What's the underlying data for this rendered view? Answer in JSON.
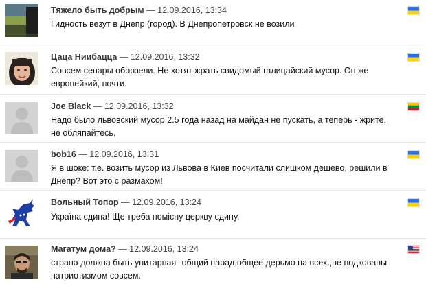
{
  "comments": [
    {
      "author": "Тяжело быть добрым",
      "separator": "—",
      "datetime": "12.09.2016, 13:34",
      "text": "Гидность везут в Днепр (город). В Днепропетровск не возили",
      "flag": "ua-flag",
      "avatar": "landscape-avatar"
    },
    {
      "author": "Цаца Ниибацца",
      "separator": "—",
      "datetime": "12.09.2016, 13:32",
      "text": "Совсем сепары оборзели. Не хотят жрать свидомый галицайский мусор. Он же европейкий, почти.",
      "flag": "ua-flag",
      "avatar": "woman-photo-avatar"
    },
    {
      "author": "Joe Black",
      "separator": "—",
      "datetime": "12.09.2016, 13:32",
      "text": "Надо было львовский мусор 2.5 года назад на майдан не пускать, а теперь - жрите, не обляпайтесь.",
      "flag": "lt-flag",
      "avatar": "default-user-avatar"
    },
    {
      "author": "bob16",
      "separator": "—",
      "datetime": "12.09.2016, 13:31",
      "text": "Я в шоке: т.е. возить мусор из Львова в Киев посчитали слишком дешево, решили в Днепр? Вот это с размахом!",
      "flag": "ua-flag",
      "avatar": "default-user-avatar"
    },
    {
      "author": "Вольный Топор",
      "separator": "—",
      "datetime": "12.09.2016, 13:24",
      "text": "Україна єдина! Ще треба помісну церкву єдину.",
      "flag": "ua-flag",
      "avatar": "donkey-logo-avatar"
    },
    {
      "author": "Магатум дома?",
      "separator": "—",
      "datetime": "12.09.2016, 13:24",
      "text": "страна должна быть унитарная--общий парад,общее дерьмо на всех.,не подкованы патриотизмом совсем.",
      "flag": "us-flag",
      "avatar": "man-photo-avatar"
    }
  ],
  "colors": {
    "ua_blue": "#2b6fd6",
    "ua_yellow": "#f4d21c",
    "lt_yellow": "#f5c400",
    "lt_green": "#0f8a3c",
    "lt_red": "#c4202b",
    "us_red": "#c8232c",
    "us_blue": "#2c3e8c",
    "avatar_gray": "#d3d3d3"
  }
}
